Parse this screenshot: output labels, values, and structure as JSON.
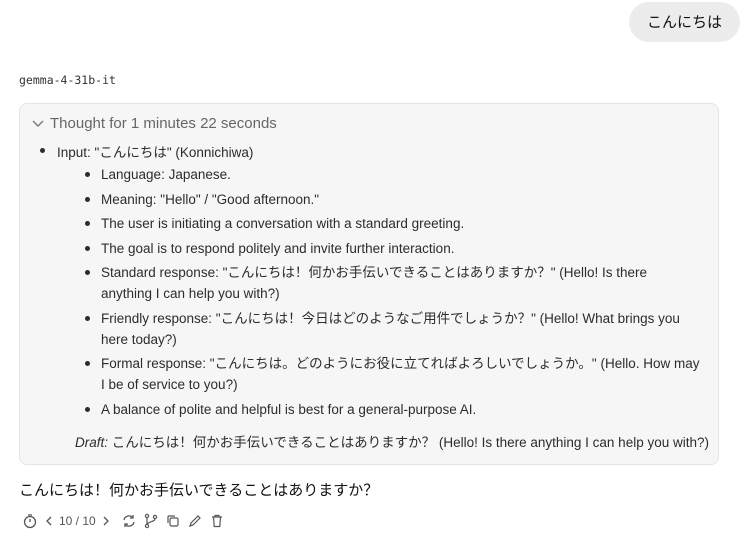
{
  "user_message": "こんにちは",
  "model_name": "gemma-4-31b-it",
  "thought": {
    "header": "Thought for 1 minutes 22 seconds",
    "input_line": "Input: \"こんにちは\" (Konnichiwa)",
    "items": [
      "Language: Japanese.",
      "Meaning: \"Hello\" / \"Good afternoon.\"",
      "The user is initiating a conversation with a standard greeting.",
      "The goal is to respond politely and invite further interaction.",
      "Standard response: \"こんにちは！何かお手伝いできることはありますか？\" (Hello! Is there anything I can help you with?)",
      "Friendly response: \"こんにちは！今日はどのようなご用件でしょうか？\" (Hello! What brings you here today?)",
      "Formal response: \"こんにちは。どのようにお役に立てればよろしいでしょうか。\" (Hello. How may I be of service to you?)",
      "A balance of polite and helpful is best for a general-purpose AI."
    ],
    "draft_label": "Draft:",
    "draft_text": " こんにちは！何かお手伝いできることはありますか？ (Hello! Is there anything I can help you with?)"
  },
  "answer": "こんにちは！何かお手伝いできることはありますか？",
  "toolbar": {
    "pager": "10 / 10",
    "icons": [
      "timer-icon",
      "chevron-left-icon",
      "chevron-right-icon",
      "regenerate-icon",
      "branch-icon",
      "copy-icon",
      "edit-icon",
      "delete-icon"
    ]
  }
}
